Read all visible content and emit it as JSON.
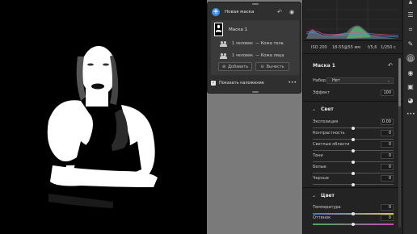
{
  "mask_popup": {
    "new_mask_label": "Новая маска",
    "mask_name": "Маска 1",
    "components": [
      {
        "who": "1 человек",
        "what": "— Кожа тела"
      },
      {
        "who": "1 человек",
        "what": "— Кожа лица"
      }
    ],
    "add_label": "Добавить",
    "subtract_label": "Вычесть",
    "show_overlay_label": "Показать наложение",
    "show_overlay_checked": true
  },
  "camera_info": {
    "iso": "ISO 200",
    "focal": "18-55@55 мм",
    "aperture": "f/5,6",
    "shutter": "1/250 с"
  },
  "mask_panel": {
    "title": "Маска 1",
    "preset_label": "Набор",
    "preset_value": "Нет",
    "effect_label": "Эффект",
    "effect_value": "100"
  },
  "light_section": {
    "title": "Свет",
    "sliders": [
      {
        "label": "Экспозиция",
        "value": "0.00",
        "position": 0.5
      },
      {
        "label": "Контрастность",
        "value": "0",
        "position": 0.5
      },
      {
        "label": "Светлые области",
        "value": "0",
        "position": 0.5
      },
      {
        "label": "Тени",
        "value": "0",
        "position": 0.5
      },
      {
        "label": "Белые",
        "value": "0",
        "position": 0.5
      },
      {
        "label": "Черные",
        "value": "0",
        "position": 0.5
      }
    ]
  },
  "color_section": {
    "title": "Цвет",
    "sliders": [
      {
        "label": "Температура",
        "value": "0",
        "position": 0.5,
        "gradient": [
          "#4a6fd6",
          "#d8c64a"
        ]
      },
      {
        "label": "Оттенок",
        "value": "0",
        "position": 0.5,
        "gradient": [
          "#4caa4c",
          "#c24ac2"
        ]
      }
    ]
  },
  "toolbar": {
    "icons": [
      "settings-sliders-icon",
      "crop-icon",
      "brush-icon",
      "mask-icon",
      "eye-icon",
      "presets-icon",
      "color-circles-icon",
      "more-icon"
    ],
    "active_index": 3
  },
  "colors": {
    "accent": "#3d8ff0",
    "panel_bg": "#232323",
    "popup_bg": "#2f2f2f"
  }
}
